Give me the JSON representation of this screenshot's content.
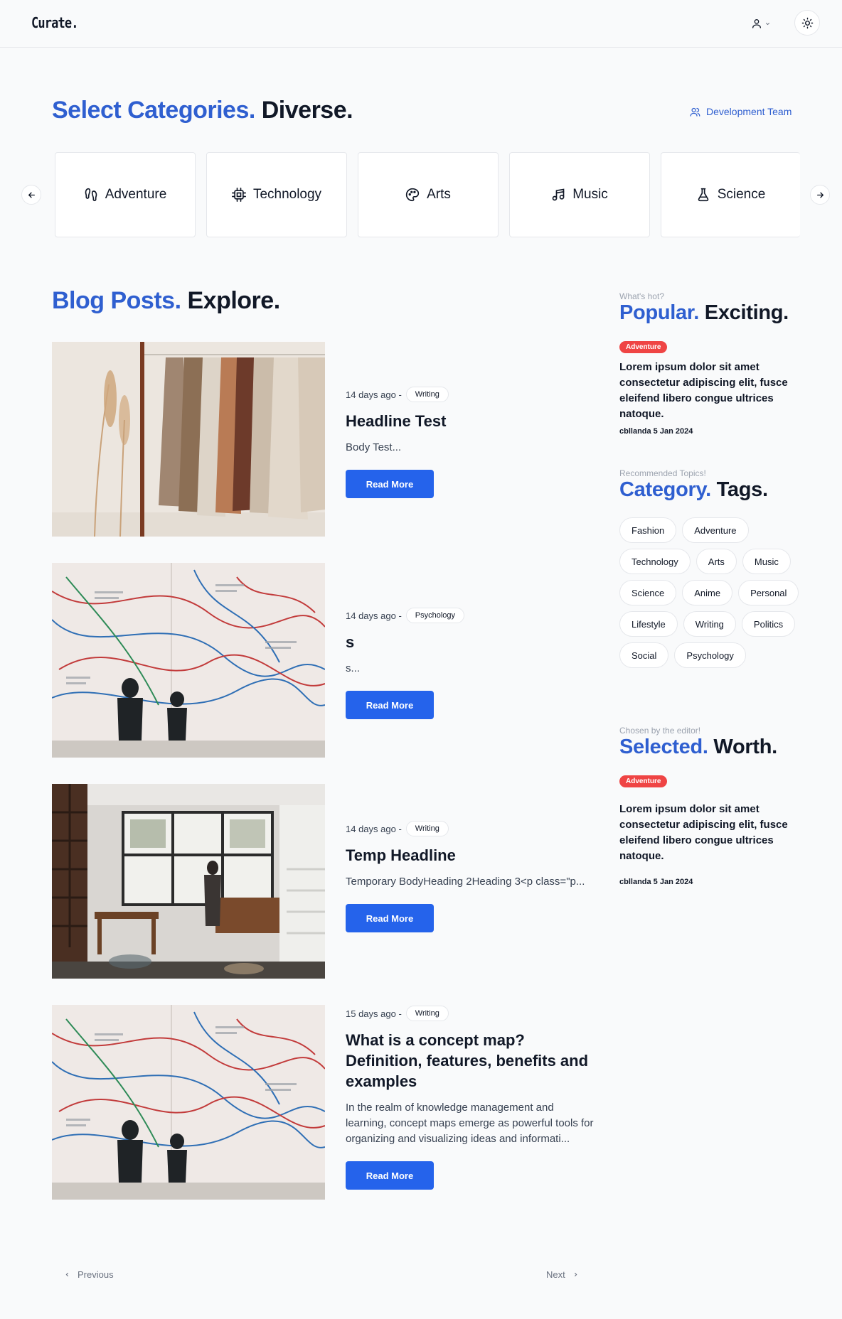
{
  "header": {
    "logo": "Curate.",
    "user_icon": "user-icon",
    "theme_icon": "sun-icon"
  },
  "categories_section": {
    "title_accent": "Select Categories.",
    "title_rest": "Diverse.",
    "team_link": "Development Team",
    "items": [
      {
        "label": "Adventure",
        "icon": "footprints-icon"
      },
      {
        "label": "Technology",
        "icon": "cpu-icon"
      },
      {
        "label": "Arts",
        "icon": "palette-icon"
      },
      {
        "label": "Music",
        "icon": "music-icon"
      },
      {
        "label": "Science",
        "icon": "flask-icon"
      }
    ]
  },
  "blog_section": {
    "title_accent": "Blog Posts.",
    "title_rest": "Explore.",
    "read_more_label": "Read More",
    "posts": [
      {
        "time": "14 days ago -",
        "tag": "Writing",
        "title": "Headline Test",
        "excerpt": "Body Test..."
      },
      {
        "time": "14 days ago -",
        "tag": "Psychology",
        "title": "s",
        "excerpt": "s..."
      },
      {
        "time": "14 days ago -",
        "tag": "Writing",
        "title": "Temp Headline",
        "excerpt": "Temporary BodyHeading 2Heading 3<p class=\"p..."
      },
      {
        "time": "15 days ago -",
        "tag": "Writing",
        "title": "What is a concept map? Definition, features, benefits and examples",
        "excerpt": "In the realm of knowledge management and learning, concept maps emerge as powerful tools for organizing and visualizing ideas and informati..."
      }
    ]
  },
  "pagination": {
    "previous": "Previous",
    "next": "Next"
  },
  "sidebar": {
    "popular": {
      "kicker": "What's hot?",
      "title_accent": "Popular.",
      "title_rest": "Exciting.",
      "badge": "Adventure",
      "text": "Lorem ipsum dolor sit amet consectetur adipiscing elit, fusce eleifend libero congue ultrices natoque.",
      "meta": "cbllanda 5 Jan 2024"
    },
    "topics": {
      "kicker": "Recommended Topics!",
      "title_accent": "Category.",
      "title_rest": "Tags.",
      "tags": [
        "Fashion",
        "Adventure",
        "Technology",
        "Arts",
        "Music",
        "Science",
        "Anime",
        "Personal",
        "Lifestyle",
        "Writing",
        "Politics",
        "Social",
        "Psychology"
      ]
    },
    "editor": {
      "kicker": "Chosen by the editor!",
      "title_accent": "Selected.",
      "title_rest": "Worth.",
      "badge": "Adventure",
      "text": "Lorem ipsum dolor sit amet consectetur adipiscing elit, fusce eleifend libero congue ultrices natoque.",
      "meta": "cbllanda 5 Jan 2024"
    }
  }
}
